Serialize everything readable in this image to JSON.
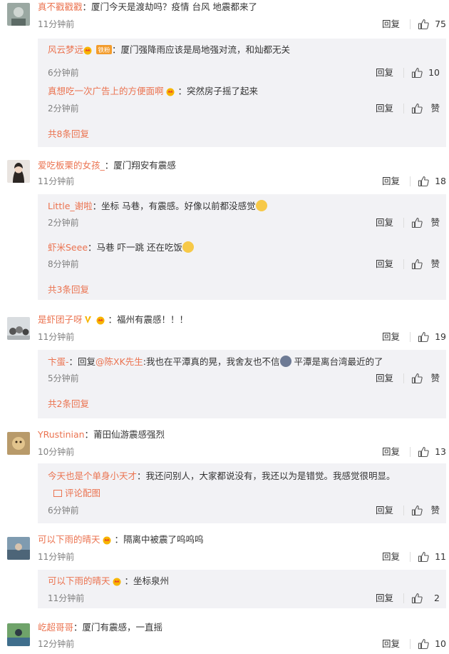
{
  "comments": [
    {
      "username": "真不戳戳戳",
      "text": "：厦门今天是渡劫吗？疫情 台风 地震都来了",
      "time": "11分钟前",
      "reply_label": "回复",
      "likes": "75",
      "replies": [
        {
          "username": "风云梦远",
          "text": "：厦门强降雨应该是局地强对流，和灿都无关",
          "time": "6分钟前",
          "reply_label": "回复",
          "likes": "10",
          "badge": "铁粉"
        },
        {
          "username": "真想吃一次广告上的方便面啊",
          "text": "：突然房子摇了起来",
          "time": "2分钟前",
          "reply_label": "回复",
          "likes": "赞"
        }
      ],
      "more": "共8条回复"
    },
    {
      "username": "爱吃板栗的女孩_",
      "text": "：厦门翔安有震感",
      "time": "11分钟前",
      "reply_label": "回复",
      "likes": "18",
      "replies": [
        {
          "username": "Little_谢啦",
          "text": "：坐标 马巷，有震感。好像以前都没感觉",
          "time": "2分钟前",
          "reply_label": "回复",
          "likes": "赞"
        },
        {
          "username": "虾米Seee",
          "text": "：马巷 吓一跳 还在吃饭",
          "time": "8分钟前",
          "reply_label": "回复",
          "likes": "赞"
        }
      ],
      "more": "共3条回复"
    },
    {
      "username": "是虾团子呀",
      "text": "：福州有震感！！！",
      "time": "11分钟前",
      "reply_label": "回复",
      "likes": "19",
      "replies": [
        {
          "username": "卞蛋-",
          "text_prefix": "：回复",
          "mention": "@陈XK先生",
          "text": ":我也在平潭真的晃，我舍友也不信",
          "text_suffix": " 平潭是离台湾最近的了",
          "time": "5分钟前",
          "reply_label": "回复",
          "likes": "赞"
        }
      ],
      "more": "共2条回复"
    },
    {
      "username": "YRustinian",
      "text": "：莆田仙游震感强烈",
      "time": "10分钟前",
      "reply_label": "回复",
      "likes": "13",
      "replies": [
        {
          "username": "今天也是个单身小天才",
          "text": "：我还问别人，大家都说没有，我还以为是错觉。我感觉很明显。",
          "picref": "评论配图",
          "time": "6分钟前",
          "reply_label": "回复",
          "likes": "赞"
        }
      ]
    },
    {
      "username": "可以下雨的晴天",
      "text": "：隔离中被震了呜呜呜",
      "time": "11分钟前",
      "reply_label": "回复",
      "likes": "11",
      "replies": [
        {
          "username": "可以下雨的晴天",
          "text": "：坐标泉州",
          "time": "11分钟前",
          "reply_label": "回复",
          "likes": "2"
        }
      ]
    },
    {
      "username": "屹超哥哥",
      "text": "：厦门有震感，一直摇",
      "time": "12分钟前",
      "reply_label": "回复",
      "likes": "10"
    }
  ],
  "colors": {
    "username": "#eb7350",
    "text": "#333333",
    "meta": "#808080",
    "reply_bg": "#f2f2f5"
  },
  "icons": {
    "like": "thumbs-up-icon",
    "vip": "vip-crown-icon",
    "picture": "picture-icon"
  }
}
